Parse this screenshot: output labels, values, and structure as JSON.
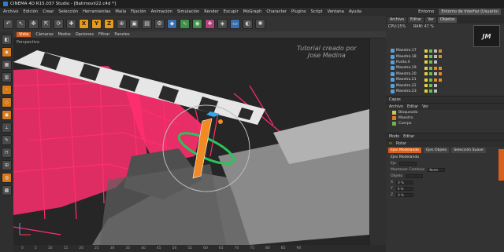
{
  "window": {
    "title": "CINEMA 4D R15.037 Studio - [Batimovil22.c4d *]"
  },
  "menu": {
    "items": [
      "Archivo",
      "Edición",
      "Crear",
      "Selección",
      "Herramientas",
      "Malla",
      "Fijación",
      "Animación",
      "Simulación",
      "Render",
      "Escupir",
      "MoGraph",
      "Character",
      "Plugins",
      "Script",
      "Ventana",
      "Ayuda"
    ],
    "right_items": [
      "Entorno",
      "Entorno de Interfaz (Usuario)"
    ]
  },
  "toolbar": {
    "axis_labels": [
      "X",
      "Y",
      "Z"
    ]
  },
  "viewport": {
    "menu": [
      "Vista",
      "Cámaras",
      "Modos",
      "Opciones",
      "Filtrar",
      "Paneles"
    ],
    "name": "Perspectiva",
    "watermark_line1": "Tutorial creado por",
    "watermark_line2": "Jose Medina"
  },
  "timeline": {
    "ticks": [
      "0",
      "5",
      "10",
      "15",
      "20",
      "25",
      "30",
      "35",
      "40",
      "45",
      "50",
      "55",
      "60",
      "65",
      "70",
      "75",
      "80",
      "85",
      "90"
    ]
  },
  "right_panel": {
    "top_tabs": [
      "Archivo",
      "Editar",
      "Ver",
      "Objetos"
    ],
    "cpu_label": "CPU:15%",
    "ram_label": "RAM: 47 %",
    "objects": [
      {
        "name": "Maestro.17"
      },
      {
        "name": "Maestro.18"
      },
      {
        "name": "Punto.4"
      },
      {
        "name": "Maestro.19"
      },
      {
        "name": "Maestro.20"
      },
      {
        "name": "Maestro.21"
      },
      {
        "name": "Maestro.22"
      },
      {
        "name": "Maestro.23"
      }
    ],
    "layers_header": "Capas",
    "layers_menu": [
      "Archivo",
      "Editar",
      "Ver"
    ],
    "layers": [
      {
        "name": "Bloqueado",
        "color": "#d7c24b"
      },
      {
        "name": "Maestro",
        "color": "#e07a2a"
      },
      {
        "name": "Cuerpo",
        "color": "#6fb34b"
      }
    ],
    "attr_menu": [
      "Modo",
      "Editar"
    ],
    "attr_title": "Rotar",
    "attr_tabs": [
      "Ejes Modelando",
      "Ejes Objeto",
      "Selección Suave"
    ],
    "attr_section": "Ejes Modelando",
    "attr_rows": [
      {
        "label": "Eje",
        "value": ""
      },
      {
        "label": "Mantener Cambios",
        "value": "Norte"
      },
      {
        "label": "Objeto",
        "value": ""
      },
      {
        "label": "X",
        "value": "0 %"
      },
      {
        "label": "Y",
        "value": "0 %"
      },
      {
        "label": "Z",
        "value": "0 %"
      }
    ]
  },
  "colors": {
    "accent": "#d9601e",
    "wire": "#ff2f6e"
  }
}
